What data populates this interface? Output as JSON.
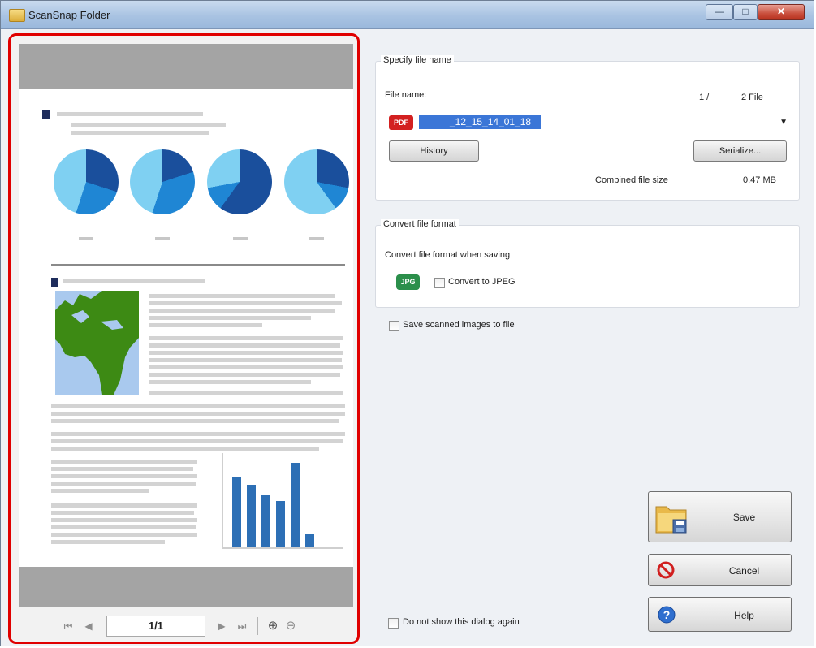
{
  "window": {
    "title": "ScanSnap Folder",
    "controls": {
      "minimize": "—",
      "maximize": "□",
      "close": "✕"
    }
  },
  "preview": {
    "navigation": {
      "page_indicator": "1/1",
      "first_glyph": "⏮",
      "prev_glyph": "◀",
      "next_glyph": "▶",
      "last_glyph": "⏭",
      "zoom_in_glyph": "⊕",
      "zoom_out_glyph": "⊖"
    }
  },
  "file_name_group": {
    "legend": "Specify file name",
    "file_name_label": "File name:",
    "file_count": "1 /",
    "file_total": "2 File",
    "file_type_icon": "PDF",
    "file_name_value": "_12_15_14_01_18",
    "history_button": "History",
    "serialize_button": "Serialize...",
    "combined_size_label": "Combined file size",
    "combined_size_value": "0.47 MB"
  },
  "convert_group": {
    "legend": "Convert file format",
    "instruction": "Convert file format when saving",
    "jpg_icon": "JPG",
    "convert_checkbox_label": "Convert to JPEG",
    "convert_checked": false
  },
  "save_images": {
    "label": "Save scanned images to file",
    "checked": false
  },
  "do_not_show": {
    "label": "Do not show this dialog again",
    "checked": false
  },
  "actions": {
    "save": "Save",
    "cancel": "Cancel",
    "help": "Help"
  },
  "colors": {
    "highlight_border": "#e00000",
    "pie_dark": "#1a4f9c",
    "pie_mid": "#1f86d4",
    "pie_light": "#7fd0f2",
    "selection": "#3b76d7"
  }
}
